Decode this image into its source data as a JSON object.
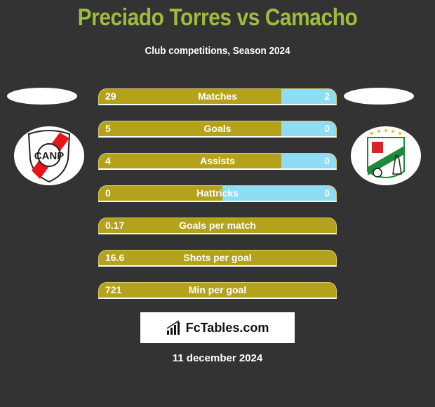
{
  "header": {
    "title": "Preciado Torres vs Camacho",
    "subtitle": "Club competitions, Season 2024"
  },
  "colors": {
    "left": "#b5a21c",
    "right": "#8fdcf5",
    "title": "#9dbb3e"
  },
  "left_team": {
    "logo": "nacional-potosi-crest-icon"
  },
  "right_team": {
    "logo": "oriente-petrolero-crest-icon"
  },
  "stats": [
    {
      "label": "Matches",
      "left": "29",
      "right": "2",
      "right_share": 0.23
    },
    {
      "label": "Goals",
      "left": "5",
      "right": "0",
      "right_share": 0.23
    },
    {
      "label": "Assists",
      "left": "4",
      "right": "0",
      "right_share": 0.23
    },
    {
      "label": "Hattricks",
      "left": "0",
      "right": "0",
      "right_share": 0.48
    },
    {
      "label": "Goals per match",
      "left": "0.17",
      "right": "",
      "right_share": 0
    },
    {
      "label": "Shots per goal",
      "left": "16.6",
      "right": "",
      "right_share": 0
    },
    {
      "label": "Min per goal",
      "left": "721",
      "right": "",
      "right_share": 0
    }
  ],
  "brand": {
    "name": "FcTables.com",
    "icon": "bar-chart-icon"
  },
  "date": "11 december 2024"
}
